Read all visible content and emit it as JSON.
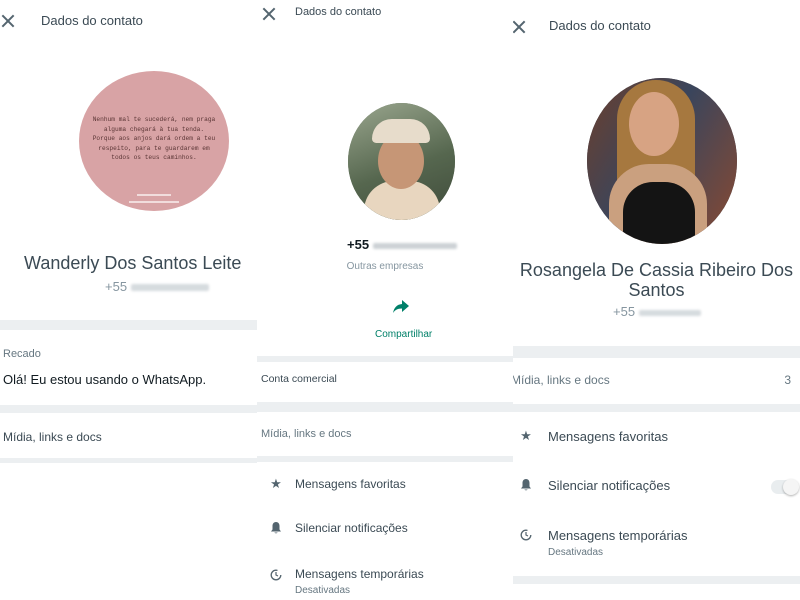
{
  "panel1": {
    "header_title": "Dados do contato",
    "quote_text": "Nenhum mal te sucederá, nem praga alguma chegará à tua tenda. Porque aos anjos dará ordem a teu respeito, para te guardarem em todos os teus caminhos.",
    "name": "Wanderly Dos Santos Leite",
    "phone": "+55",
    "about_label": "Recado",
    "about_text": "Olá! Eu estou usando o WhatsApp.",
    "media_label": "Mídia, links e docs"
  },
  "panel2": {
    "header_title": "Dados do contato",
    "phone": "+55",
    "category": "Outras empresas",
    "share_label": "Compartilhar",
    "business_label": "Conta comercial",
    "media_label": "Mídia, links e docs",
    "starred_label": "Mensagens favoritas",
    "mute_label": "Silenciar notificações",
    "disappearing_label": "Mensagens temporárias",
    "disappearing_sub": "Desativadas"
  },
  "panel3": {
    "header_title": "Dados do contato",
    "name_line1": "Rosangela De Cassia Ribeiro Dos",
    "name_line2": "Santos",
    "phone": "+55",
    "media_label": "Mídia, links e docs",
    "media_count": "3",
    "starred_label": "Mensagens favoritas",
    "mute_label": "Silenciar notificações",
    "disappearing_label": "Mensagens temporárias",
    "disappearing_sub": "Desativadas"
  },
  "colors": {
    "share_green": "#008069",
    "avatar1_bg": "#d8a3a5",
    "divider": "#eceff1"
  },
  "icons": {
    "close": "close-icon",
    "share": "share-arrow-icon",
    "star": "star-icon",
    "bell": "bell-icon",
    "timer": "timer-icon"
  }
}
